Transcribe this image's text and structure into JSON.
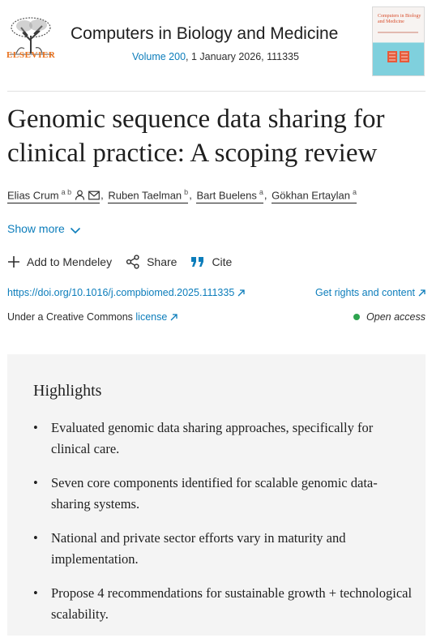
{
  "header": {
    "publisher": "ELSEVIER",
    "journal_title": "Computers in Biology and Medicine",
    "volume_link": "Volume 200",
    "issue_rest": ", 1 January 2026, 111335",
    "cover_title": "Computers in Biology and Medicine"
  },
  "article": {
    "title": "Genomic sequence data sharing for clinical practice: A scoping review"
  },
  "authors": [
    {
      "name": "Elias Crum",
      "affil": "a b"
    },
    {
      "name": "Ruben Taelman",
      "affil": "b"
    },
    {
      "name": "Bart Buelens",
      "affil": "a"
    },
    {
      "name": "Gökhan Ertaylan",
      "affil": "a"
    }
  ],
  "show_more": "Show more",
  "actions": {
    "mendeley": "Add to Mendeley",
    "share": "Share",
    "cite": "Cite"
  },
  "links": {
    "doi": "https://doi.org/10.1016/j.compbiomed.2025.111335",
    "rights": "Get rights and content",
    "license_prefix": "Under a Creative Commons ",
    "license_link": "license",
    "open_access": "Open access"
  },
  "highlights": {
    "title": "Highlights",
    "items": [
      "Evaluated genomic data sharing approaches, specifically for clinical care.",
      "Seven core components identified for scalable genomic data-sharing systems.",
      "National and private sector efforts vary in maturity and implementation.",
      "Propose 4 recommendations for sustainable growth + technological scalability."
    ]
  },
  "colors": {
    "link": "#0c7dbb",
    "publisher_orange": "#e9711c",
    "open_access_dot": "#2ea44f",
    "highlight_bg": "#f4f4f4"
  },
  "icons": [
    "elsevier-tree-logo",
    "person-icon",
    "envelope-icon",
    "chevron-down-icon",
    "plus-icon",
    "share-icon",
    "quote-icon",
    "external-arrow-icon"
  ]
}
